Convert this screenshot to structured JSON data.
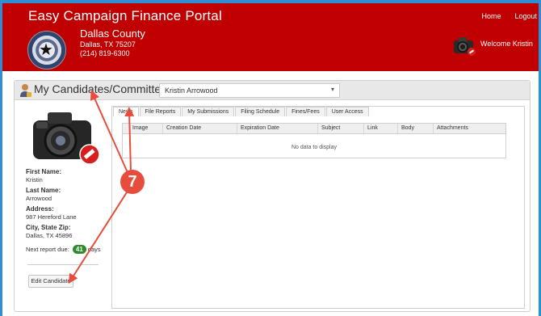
{
  "header": {
    "portal_title": "Easy Campaign Finance Portal",
    "county": "Dallas County",
    "address_line": "Dallas, TX 75207",
    "phone": "(214) 819-6300",
    "nav": {
      "home": "Home",
      "logout": "Logout"
    },
    "welcome": "Welcome Kristin",
    "seal_icon": "county-seal-icon"
  },
  "panel": {
    "title": "My Candidates/Committees",
    "selected_candidate": "Kristin Arrowood",
    "select_caret": "▾"
  },
  "candidate": {
    "first_name_label": "First Name:",
    "first_name": "Kristin",
    "last_name_label": "Last Name:",
    "last_name": "Arrowood",
    "address_label": "Address:",
    "address": "987 Hereford Lane",
    "city_label": "City, State Zip:",
    "city": "Dallas, TX 45896",
    "report_due_label": "Next report due:",
    "report_due_days": "41",
    "report_due_unit": "days",
    "edit_button": "Edit Candidate"
  },
  "tabs": [
    {
      "label": "News",
      "active": true
    },
    {
      "label": "File Reports",
      "active": false
    },
    {
      "label": "My Submissions",
      "active": false
    },
    {
      "label": "Filing Schedule",
      "active": false
    },
    {
      "label": "Fines/Fees",
      "active": false
    },
    {
      "label": "User Access",
      "active": false
    }
  ],
  "grid": {
    "columns": [
      "Image",
      "Creation Date",
      "Expiration Date",
      "Subject",
      "Link",
      "Body",
      "Attachments"
    ],
    "empty_message": "No data to display"
  },
  "annotation": {
    "step_number": "7",
    "color": "#e74c3c"
  },
  "colors": {
    "header_bg": "#c00000",
    "frame": "#2e8fd6",
    "badge": "#2e8b2e"
  }
}
